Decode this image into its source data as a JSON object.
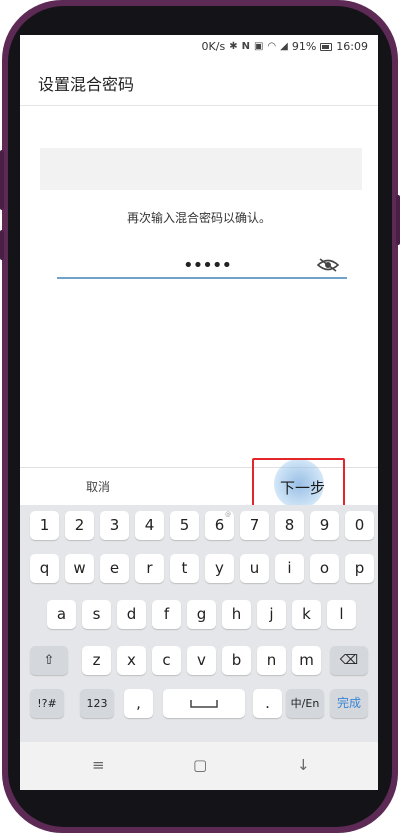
{
  "status_bar": {
    "speed": "0K/s",
    "battery": "91%",
    "time": "16:09",
    "icons": [
      "bluetooth-icon",
      "nfc-icon",
      "vibrate-icon",
      "wifi-icon",
      "signal-icon",
      "battery-icon"
    ]
  },
  "page": {
    "title": "设置混合密码",
    "prompt": "再次输入混合密码以确认。",
    "password_mask": "•••••"
  },
  "actions": {
    "cancel": "取消",
    "next": "下一步"
  },
  "keyboard": {
    "number_row": [
      {
        "key": "1",
        "hint": ""
      },
      {
        "key": "2",
        "hint": ""
      },
      {
        "key": "3",
        "hint": ""
      },
      {
        "key": "4",
        "hint": ""
      },
      {
        "key": "5",
        "hint": ""
      },
      {
        "key": "6",
        "hint": "@"
      },
      {
        "key": "7",
        "hint": ""
      },
      {
        "key": "8",
        "hint": ""
      },
      {
        "key": "9",
        "hint": ""
      },
      {
        "key": "0",
        "hint": ""
      }
    ],
    "row1": [
      {
        "key": "q",
        "hint": ""
      },
      {
        "key": "w",
        "hint": ""
      },
      {
        "key": "e",
        "hint": ""
      },
      {
        "key": "r",
        "hint": ""
      },
      {
        "key": "t",
        "hint": ""
      },
      {
        "key": "y",
        "hint": ""
      },
      {
        "key": "u",
        "hint": ""
      },
      {
        "key": "i",
        "hint": ""
      },
      {
        "key": "o",
        "hint": ""
      },
      {
        "key": "p",
        "hint": ""
      }
    ],
    "row2": [
      {
        "key": "a",
        "hint": ""
      },
      {
        "key": "s",
        "hint": ""
      },
      {
        "key": "d",
        "hint": ""
      },
      {
        "key": "f",
        "hint": ""
      },
      {
        "key": "g",
        "hint": ""
      },
      {
        "key": "h",
        "hint": ""
      },
      {
        "key": "j",
        "hint": ""
      },
      {
        "key": "k",
        "hint": ""
      },
      {
        "key": "l",
        "hint": ""
      }
    ],
    "row3": [
      {
        "key": "z",
        "hint": ""
      },
      {
        "key": "x",
        "hint": ""
      },
      {
        "key": "c",
        "hint": ""
      },
      {
        "key": "v",
        "hint": ""
      },
      {
        "key": "b",
        "hint": ""
      },
      {
        "key": "n",
        "hint": ""
      },
      {
        "key": "m",
        "hint": ""
      }
    ],
    "symbols": "!?#",
    "numbers": "123",
    "comma": ",",
    "period": ".",
    "lang": "中/En",
    "done": "完成"
  }
}
